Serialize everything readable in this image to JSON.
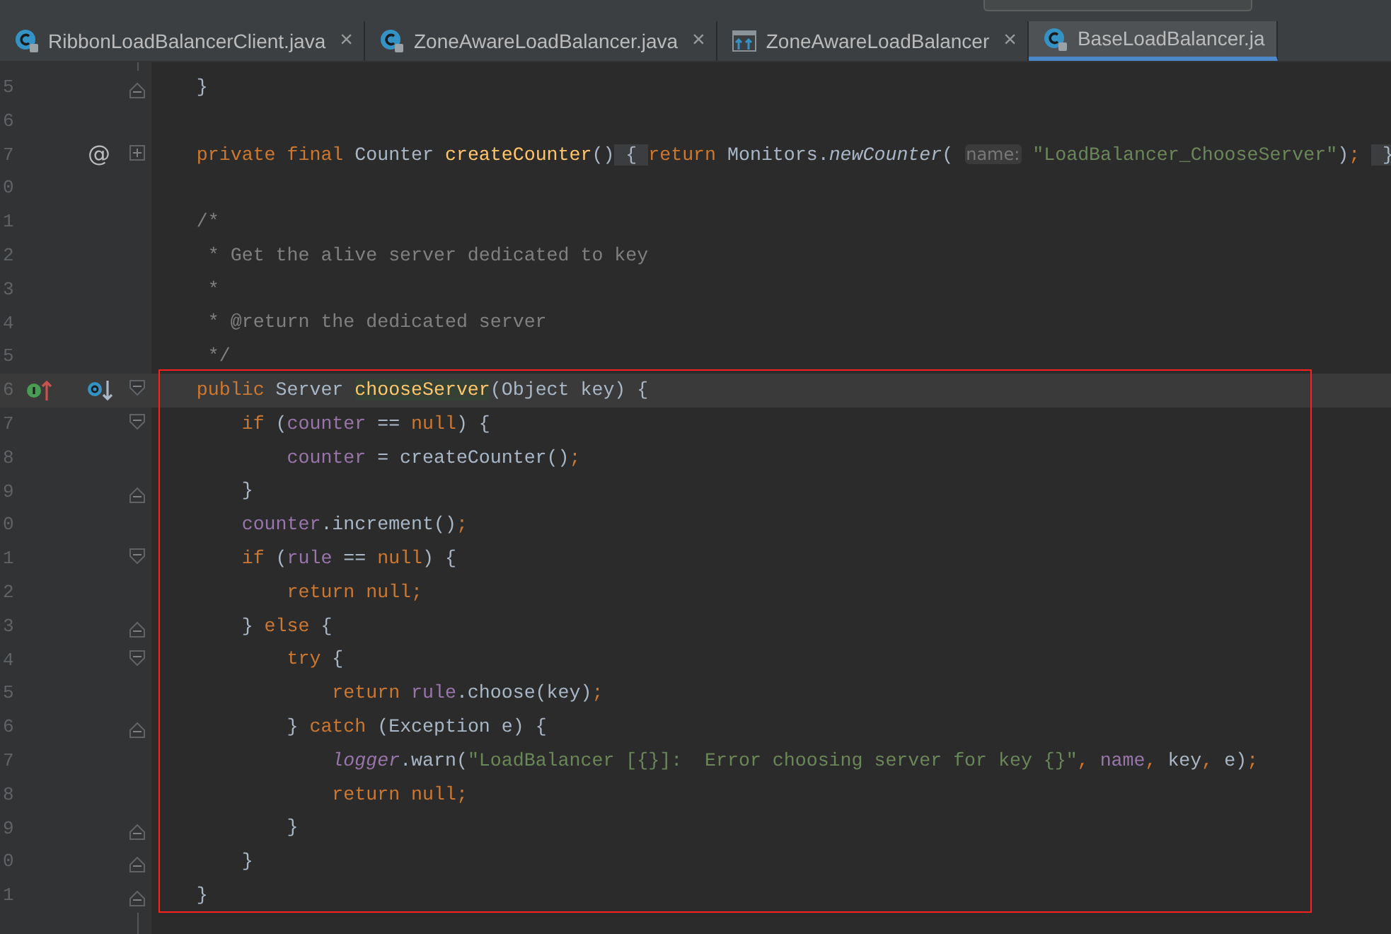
{
  "tabs": [
    {
      "label": "RibbonLoadBalancerClient.java",
      "kind": "class",
      "close": "×",
      "selected": false
    },
    {
      "label": "ZoneAwareLoadBalancer.java",
      "kind": "class",
      "close": "×",
      "selected": false
    },
    {
      "label": "ZoneAwareLoadBalancer",
      "kind": "hierarchy",
      "close": "×",
      "selected": false
    },
    {
      "label": "BaseLoadBalancer.ja",
      "kind": "class",
      "selected": true
    }
  ],
  "annotation_frame": true,
  "lines": [
    {
      "number": "5",
      "fold": {
        "kind": "end"
      },
      "current": false,
      "tokens": [
        {
          "text": "    }",
          "kind": "plain"
        }
      ]
    },
    {
      "number": "6",
      "current": false
    },
    {
      "number": "7",
      "fold": {
        "kind": "plus"
      },
      "gutter": "@",
      "current": false,
      "tokens": [
        {
          "text": "    private final ",
          "kind": "keyword"
        },
        {
          "text": "Counter ",
          "kind": "plain"
        },
        {
          "text": "createCounter",
          "kind": "decl"
        },
        {
          "text": "()",
          "kind": "plain"
        },
        {
          "text": " { ",
          "kind": "folded"
        },
        {
          "text": "return ",
          "kind": "keyword"
        },
        {
          "text": "Monitors.",
          "kind": "plain"
        },
        {
          "text": "newCounter",
          "kind": "static"
        },
        {
          "text": "( ",
          "kind": "plain"
        },
        {
          "text": "name:",
          "kind": "hint"
        },
        {
          "text": " \"LoadBalancer_ChooseServer\"",
          "kind": "string"
        },
        {
          "text": ")",
          "kind": "plain"
        },
        {
          "text": "; ",
          "kind": "keyword"
        },
        {
          "text": " } ",
          "kind": "folded"
        }
      ]
    },
    {
      "number": "0",
      "current": false
    },
    {
      "number": "1",
      "current": false,
      "tokens": [
        {
          "text": "    /*",
          "kind": "comment"
        }
      ]
    },
    {
      "number": "2",
      "current": false,
      "tokens": [
        {
          "text": "     * Get the alive server dedicated to key",
          "kind": "comment"
        }
      ]
    },
    {
      "number": "3",
      "current": false,
      "tokens": [
        {
          "text": "     *",
          "kind": "comment"
        }
      ]
    },
    {
      "number": "4",
      "current": false,
      "tokens": [
        {
          "text": "     * @return the dedicated server",
          "kind": "comment"
        }
      ]
    },
    {
      "number": "5",
      "current": false,
      "tokens": [
        {
          "text": "     */",
          "kind": "comment"
        }
      ]
    },
    {
      "number": "6",
      "fold": {
        "kind": "start"
      },
      "markers": [
        {
          "kind": "implements"
        },
        {
          "kind": "overridden"
        }
      ],
      "current": true,
      "tokens": [
        {
          "text": "    public ",
          "kind": "keyword"
        },
        {
          "text": "Server ",
          "kind": "plain"
        },
        {
          "text": "chooseServer",
          "kind": "match"
        },
        {
          "text": "(Object key) {",
          "kind": "plain"
        }
      ]
    },
    {
      "number": "7",
      "fold": {
        "kind": "start"
      },
      "current": false,
      "tokens": [
        {
          "text": "        if ",
          "kind": "keyword"
        },
        {
          "text": "(",
          "kind": "plain"
        },
        {
          "text": "counter",
          "kind": "field"
        },
        {
          "text": " == ",
          "kind": "plain"
        },
        {
          "text": "null",
          "kind": "keyword"
        },
        {
          "text": ") {",
          "kind": "plain"
        }
      ]
    },
    {
      "number": "8",
      "current": false,
      "tokens": [
        {
          "text": "            counter",
          "kind": "field"
        },
        {
          "text": " = createCounter()",
          "kind": "plain"
        },
        {
          "text": ";",
          "kind": "keyword"
        }
      ]
    },
    {
      "number": "9",
      "fold": {
        "kind": "end"
      },
      "current": false,
      "tokens": [
        {
          "text": "        }",
          "kind": "plain"
        }
      ]
    },
    {
      "number": "0",
      "current": false,
      "tokens": [
        {
          "text": "        counter",
          "kind": "field"
        },
        {
          "text": ".increment()",
          "kind": "plain"
        },
        {
          "text": ";",
          "kind": "keyword"
        }
      ]
    },
    {
      "number": "1",
      "fold": {
        "kind": "start"
      },
      "current": false,
      "tokens": [
        {
          "text": "        if ",
          "kind": "keyword"
        },
        {
          "text": "(",
          "kind": "plain"
        },
        {
          "text": "rule",
          "kind": "field"
        },
        {
          "text": " == ",
          "kind": "plain"
        },
        {
          "text": "null",
          "kind": "keyword"
        },
        {
          "text": ") {",
          "kind": "plain"
        }
      ]
    },
    {
      "number": "2",
      "current": false,
      "tokens": [
        {
          "text": "            return null;",
          "kind": "keyword"
        }
      ]
    },
    {
      "number": "3",
      "fold": {
        "kind": "end"
      },
      "current": false,
      "tokens": [
        {
          "text": "        } ",
          "kind": "plain"
        },
        {
          "text": "else ",
          "kind": "keyword"
        },
        {
          "text": "{",
          "kind": "plain"
        }
      ]
    },
    {
      "number": "4",
      "fold": {
        "kind": "start"
      },
      "current": false,
      "tokens": [
        {
          "text": "            try ",
          "kind": "keyword"
        },
        {
          "text": "{",
          "kind": "plain"
        }
      ]
    },
    {
      "number": "5",
      "current": false,
      "tokens": [
        {
          "text": "                return ",
          "kind": "keyword"
        },
        {
          "text": "rule",
          "kind": "field"
        },
        {
          "text": ".choose(key)",
          "kind": "plain"
        },
        {
          "text": ";",
          "kind": "keyword"
        }
      ]
    },
    {
      "number": "6",
      "fold": {
        "kind": "end"
      },
      "current": false,
      "tokens": [
        {
          "text": "            } ",
          "kind": "plain"
        },
        {
          "text": "catch ",
          "kind": "keyword"
        },
        {
          "text": "(Exception e) {",
          "kind": "plain"
        }
      ]
    },
    {
      "number": "7",
      "current": false,
      "tokens": [
        {
          "text": "                logger",
          "kind": "static_field"
        },
        {
          "text": ".warn(",
          "kind": "plain"
        },
        {
          "text": "\"LoadBalancer [{}]:  Error choosing server for key {}\"",
          "kind": "string"
        },
        {
          "text": ", ",
          "kind": "keyword"
        },
        {
          "text": "name",
          "kind": "field"
        },
        {
          "text": ", ",
          "kind": "keyword"
        },
        {
          "text": "key",
          "kind": "plain"
        },
        {
          "text": ", ",
          "kind": "keyword"
        },
        {
          "text": "e)",
          "kind": "plain"
        },
        {
          "text": ";",
          "kind": "keyword"
        }
      ]
    },
    {
      "number": "8",
      "current": false,
      "tokens": [
        {
          "text": "                return null;",
          "kind": "keyword"
        }
      ]
    },
    {
      "number": "9",
      "fold": {
        "kind": "end"
      },
      "current": false,
      "tokens": [
        {
          "text": "            }",
          "kind": "plain"
        }
      ]
    },
    {
      "number": "0",
      "fold": {
        "kind": "end"
      },
      "current": false,
      "tokens": [
        {
          "text": "        }",
          "kind": "plain"
        }
      ]
    },
    {
      "number": "1",
      "fold": {
        "kind": "end"
      },
      "current": false,
      "tokens": [
        {
          "text": "    }",
          "kind": "plain"
        }
      ]
    }
  ]
}
